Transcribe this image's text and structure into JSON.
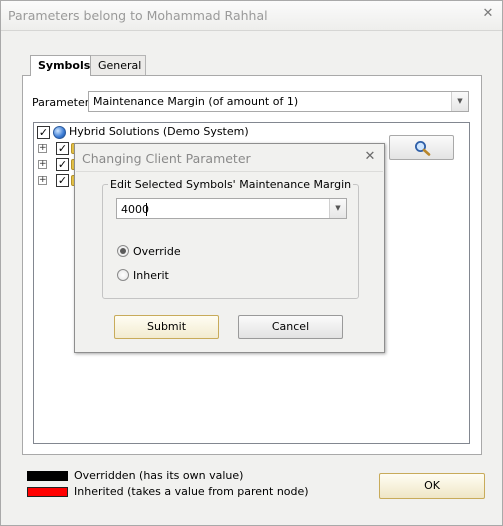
{
  "window": {
    "title": "Parameters belong to Mohammad Rahhal",
    "close_glyph": "✕"
  },
  "tabs": [
    {
      "label": "Symbols",
      "active": true
    },
    {
      "label": "General",
      "active": false
    }
  ],
  "parameter": {
    "label": "Parameter",
    "value": "Maintenance Margin (of amount of 1)",
    "dropdown_glyph": "▼"
  },
  "tree": {
    "root_label": "Hybrid Solutions (Demo System)",
    "check_glyph": "✓",
    "expand_glyph": "+"
  },
  "search_button": {
    "icon": "magnifier-icon"
  },
  "dialog": {
    "title": "Changing Client Parameter",
    "close_glyph": "✕",
    "group_label": "Edit Selected Symbols' Maintenance Margin",
    "value": "4000",
    "dropdown_glyph": "▼",
    "options": [
      {
        "label": "Override",
        "selected": true
      },
      {
        "label": "Inherit",
        "selected": false
      }
    ],
    "submit_label": "Submit",
    "cancel_label": "Cancel"
  },
  "legend": [
    {
      "color": "#000000",
      "label": "Overridden (has its own value)"
    },
    {
      "color": "#ff0000",
      "label": "Inherited (takes a value from parent node)"
    }
  ],
  "ok_label": "OK"
}
